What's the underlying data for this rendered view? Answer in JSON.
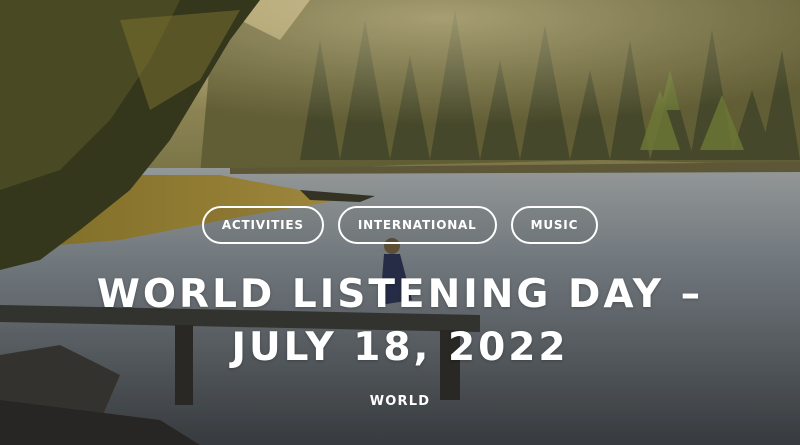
{
  "tags": [
    {
      "label": "ACTIVITIES"
    },
    {
      "label": "INTERNATIONAL"
    },
    {
      "label": "MUSIC"
    }
  ],
  "article": {
    "title_line1": "WORLD LISTENING DAY –",
    "title_line2": "JULY 18, 2022",
    "category": "WORLD"
  },
  "colors": {
    "text": "#ffffff",
    "tag_border": "#ffffff",
    "lake": "#7d8690",
    "forest": "#4a4b2e",
    "sky_haze": "#a79a62"
  }
}
